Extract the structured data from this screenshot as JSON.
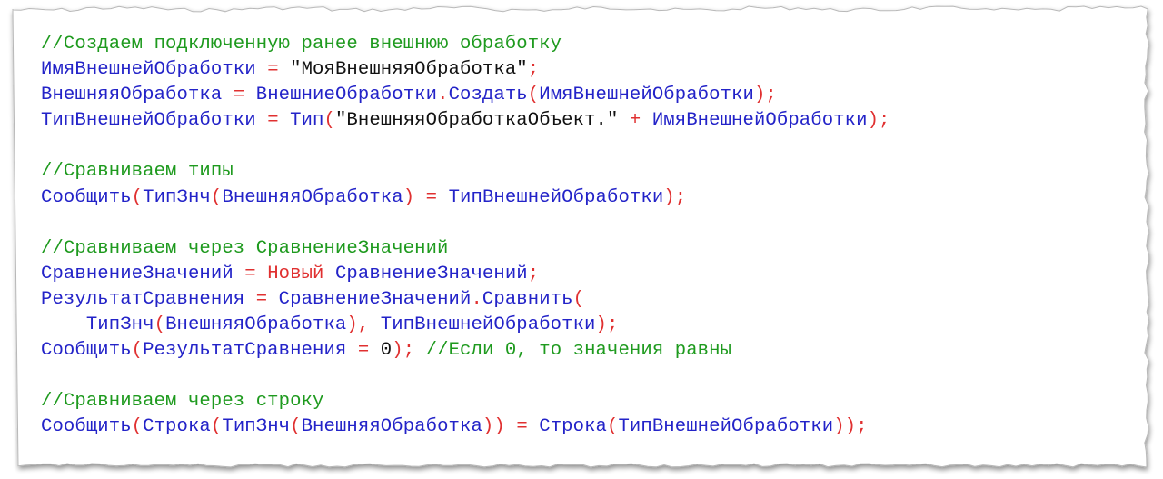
{
  "colors": {
    "comment": "#1e9a1e",
    "identifier": "#2323c8",
    "operator": "#e03030",
    "string": "#111111",
    "keyword": "#e03030"
  },
  "code_lines": [
    [
      {
        "t": "comment",
        "v": "//Создаем подключенную ранее внешнюю обработку"
      }
    ],
    [
      {
        "t": "ident",
        "v": "ИмяВнешнейОбработки"
      },
      {
        "t": "plain",
        "v": " "
      },
      {
        "t": "op",
        "v": "="
      },
      {
        "t": "plain",
        "v": " "
      },
      {
        "t": "string",
        "v": "\"МояВнешняяОбработка\""
      },
      {
        "t": "op",
        "v": ";"
      }
    ],
    [
      {
        "t": "ident",
        "v": "ВнешняяОбработка"
      },
      {
        "t": "plain",
        "v": " "
      },
      {
        "t": "op",
        "v": "="
      },
      {
        "t": "plain",
        "v": " "
      },
      {
        "t": "ident",
        "v": "ВнешниеОбработки"
      },
      {
        "t": "op",
        "v": "."
      },
      {
        "t": "ident",
        "v": "Создать"
      },
      {
        "t": "op",
        "v": "("
      },
      {
        "t": "ident",
        "v": "ИмяВнешнейОбработки"
      },
      {
        "t": "op",
        "v": ");"
      }
    ],
    [
      {
        "t": "ident",
        "v": "ТипВнешнейОбработки"
      },
      {
        "t": "plain",
        "v": " "
      },
      {
        "t": "op",
        "v": "="
      },
      {
        "t": "plain",
        "v": " "
      },
      {
        "t": "ident",
        "v": "Тип"
      },
      {
        "t": "op",
        "v": "("
      },
      {
        "t": "string",
        "v": "\"ВнешняяОбработкаОбъект.\""
      },
      {
        "t": "plain",
        "v": " "
      },
      {
        "t": "op",
        "v": "+"
      },
      {
        "t": "plain",
        "v": " "
      },
      {
        "t": "ident",
        "v": "ИмяВнешнейОбработки"
      },
      {
        "t": "op",
        "v": ");"
      }
    ],
    [],
    [
      {
        "t": "comment",
        "v": "//Сравниваем типы"
      }
    ],
    [
      {
        "t": "ident",
        "v": "Сообщить"
      },
      {
        "t": "op",
        "v": "("
      },
      {
        "t": "ident",
        "v": "ТипЗнч"
      },
      {
        "t": "op",
        "v": "("
      },
      {
        "t": "ident",
        "v": "ВнешняяОбработка"
      },
      {
        "t": "op",
        "v": ")"
      },
      {
        "t": "plain",
        "v": " "
      },
      {
        "t": "op",
        "v": "="
      },
      {
        "t": "plain",
        "v": " "
      },
      {
        "t": "ident",
        "v": "ТипВнешнейОбработки"
      },
      {
        "t": "op",
        "v": ");"
      }
    ],
    [],
    [
      {
        "t": "comment",
        "v": "//Сравниваем через СравнениеЗначений"
      }
    ],
    [
      {
        "t": "ident",
        "v": "СравнениеЗначений"
      },
      {
        "t": "plain",
        "v": " "
      },
      {
        "t": "op",
        "v": "="
      },
      {
        "t": "plain",
        "v": " "
      },
      {
        "t": "keyword",
        "v": "Новый"
      },
      {
        "t": "plain",
        "v": " "
      },
      {
        "t": "ident",
        "v": "СравнениеЗначений"
      },
      {
        "t": "op",
        "v": ";"
      }
    ],
    [
      {
        "t": "ident",
        "v": "РезультатСравнения"
      },
      {
        "t": "plain",
        "v": " "
      },
      {
        "t": "op",
        "v": "="
      },
      {
        "t": "plain",
        "v": " "
      },
      {
        "t": "ident",
        "v": "СравнениеЗначений"
      },
      {
        "t": "op",
        "v": "."
      },
      {
        "t": "ident",
        "v": "Сравнить"
      },
      {
        "t": "op",
        "v": "("
      }
    ],
    [
      {
        "t": "plain",
        "v": "    "
      },
      {
        "t": "ident",
        "v": "ТипЗнч"
      },
      {
        "t": "op",
        "v": "("
      },
      {
        "t": "ident",
        "v": "ВнешняяОбработка"
      },
      {
        "t": "op",
        "v": "),"
      },
      {
        "t": "plain",
        "v": " "
      },
      {
        "t": "ident",
        "v": "ТипВнешнейОбработки"
      },
      {
        "t": "op",
        "v": ");"
      }
    ],
    [
      {
        "t": "ident",
        "v": "Сообщить"
      },
      {
        "t": "op",
        "v": "("
      },
      {
        "t": "ident",
        "v": "РезультатСравнения"
      },
      {
        "t": "plain",
        "v": " "
      },
      {
        "t": "op",
        "v": "="
      },
      {
        "t": "plain",
        "v": " "
      },
      {
        "t": "number",
        "v": "0"
      },
      {
        "t": "op",
        "v": ");"
      },
      {
        "t": "plain",
        "v": " "
      },
      {
        "t": "comment",
        "v": "//Если 0, то значения равны"
      }
    ],
    [],
    [
      {
        "t": "comment",
        "v": "//Сравниваем через строку"
      }
    ],
    [
      {
        "t": "ident",
        "v": "Сообщить"
      },
      {
        "t": "op",
        "v": "("
      },
      {
        "t": "ident",
        "v": "Строка"
      },
      {
        "t": "op",
        "v": "("
      },
      {
        "t": "ident",
        "v": "ТипЗнч"
      },
      {
        "t": "op",
        "v": "("
      },
      {
        "t": "ident",
        "v": "ВнешняяОбработка"
      },
      {
        "t": "op",
        "v": "))"
      },
      {
        "t": "plain",
        "v": " "
      },
      {
        "t": "op",
        "v": "="
      },
      {
        "t": "plain",
        "v": " "
      },
      {
        "t": "ident",
        "v": "Строка"
      },
      {
        "t": "op",
        "v": "("
      },
      {
        "t": "ident",
        "v": "ТипВнешнейОбработки"
      },
      {
        "t": "op",
        "v": "));"
      }
    ]
  ]
}
